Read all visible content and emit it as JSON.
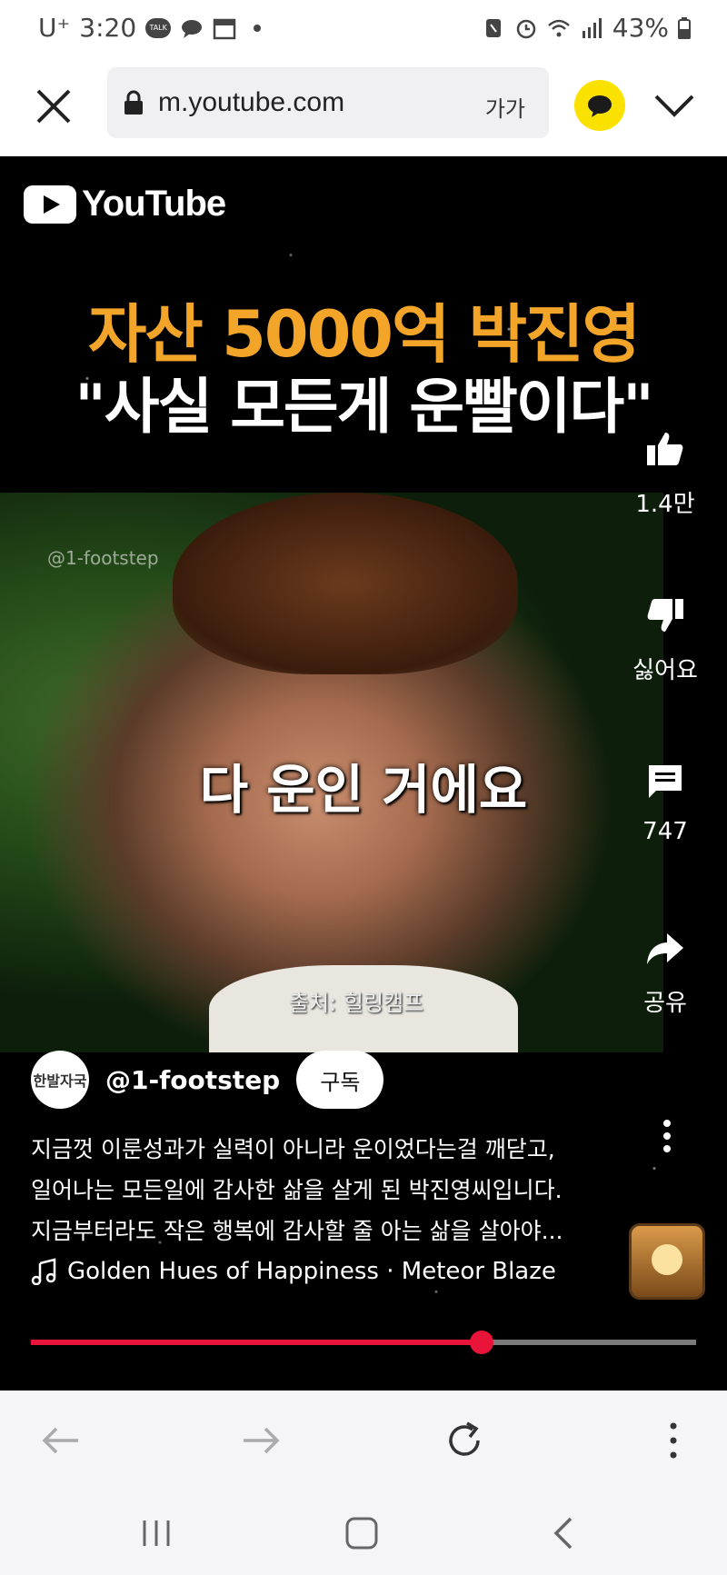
{
  "status_bar": {
    "carrier": "U⁺",
    "time": "3:20",
    "notification_icons": [
      "talk-icon",
      "chat-bubble-icon",
      "calendar-icon",
      "dot-icon"
    ],
    "right_icons": [
      "nfc-icon",
      "alarm-icon",
      "wifi-icon",
      "signal-icon"
    ],
    "battery": "43%"
  },
  "browser": {
    "url": "m.youtube.com",
    "text_size_label": "가가",
    "close_icon": "close-icon",
    "chevron_icon": "chevron-down-icon"
  },
  "video": {
    "logo_text": "YouTube",
    "headline_line1": "자산 5000억 박진영",
    "headline_line2": "\"사실 모든게 운빨이다\"",
    "watermark": "@1-footstep",
    "subtitle": "다 운인 거에요",
    "source": "출처: 힐링캠프"
  },
  "actions": {
    "like_count": "1.4만",
    "dislike_label": "싫어요",
    "comment_count": "747",
    "share_label": "공유"
  },
  "channel": {
    "avatar_text": "한발자국",
    "handle": "@1-footstep",
    "subscribe_label": "구독"
  },
  "description": {
    "lines": [
      "지금껏 이룬성과가 실력이 아니라 운이었다는걸 깨닫고,",
      "일어나는 모든일에 감사한 삶을 살게 된 박진영씨입니다.",
      "지금부터라도 작은 행복에 감사할 줄 아는 삶을 살아야..."
    ]
  },
  "music": {
    "track": "Golden Hues of Happiness · Meteor Blaze"
  },
  "progress": {
    "fraction": 0.678,
    "played_color": "#e8143a",
    "track_color": "#7a7a7a"
  },
  "colors": {
    "headline_orange": "#f3a52a",
    "kakao_yellow": "#fae100"
  }
}
